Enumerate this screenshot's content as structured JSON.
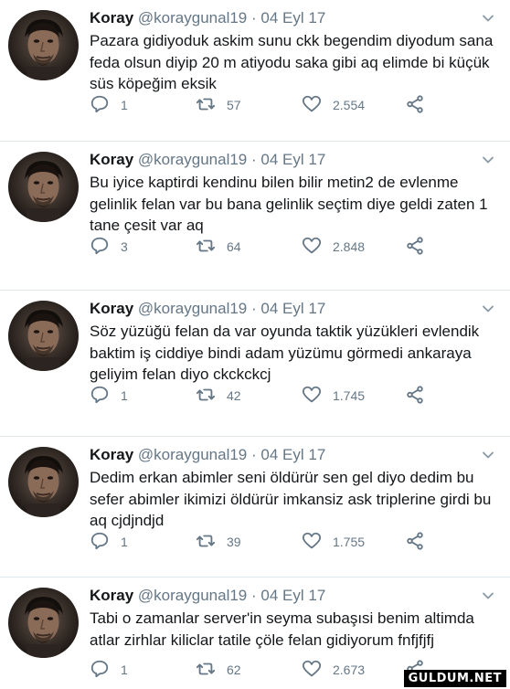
{
  "tweets": [
    {
      "name": "Koray",
      "handle": "@koraygunal19",
      "separator": "·",
      "date": "04 Eyl 17",
      "text": "Pazara gidiyoduk askim sunu ckk begendim diyodum sana feda olsun diyip 20 m atiyodu saka gibi aq elimde bi küçük süs köpeğim eksik",
      "replies": "1",
      "retweets": "57",
      "likes": "2.554"
    },
    {
      "name": "Koray",
      "handle": "@koraygunal19",
      "separator": "·",
      "date": "04 Eyl 17",
      "text": "Bu iyice kaptirdi kendinu bilen bilir metin2 de evlenme gelinlik felan var bu bana gelinlik seçtim diye geldi zaten 1 tane çesit var aq",
      "replies": "3",
      "retweets": "64",
      "likes": "2.848"
    },
    {
      "name": "Koray",
      "handle": "@koraygunal19",
      "separator": "·",
      "date": "04 Eyl 17",
      "text": "Söz yüzüğü felan da var oyunda taktik yüzükleri evlendik baktim iş ciddiye bindi adam yüzümu görmedi ankaraya geliyim felan diyo ckckckcj",
      "replies": "1",
      "retweets": "42",
      "likes": "1.745"
    },
    {
      "name": "Koray",
      "handle": "@koraygunal19",
      "separator": "·",
      "date": "04 Eyl 17",
      "text": "Dedim erkan abimler seni öldürür sen gel diyo dedim bu sefer abimler ikimizi öldürür imkansiz ask triplerine girdi bu aq cjdjndjd",
      "replies": "1",
      "retweets": "39",
      "likes": "1.755"
    },
    {
      "name": "Koray",
      "handle": "@koraygunal19",
      "separator": "·",
      "date": "04 Eyl 17",
      "text": "Tabi o zamanlar server'in seyma subaşısi benim altimda atlar zirhlar kiliclar tatile çöle felan gidiyorum fnfjfjfj",
      "replies": "1",
      "retweets": "62",
      "likes": "2.673"
    }
  ],
  "icons": {
    "reply": "reply-icon",
    "retweet": "retweet-icon",
    "like": "heart-icon",
    "share": "share-icon",
    "menu": "chevron-down-icon"
  },
  "colors": {
    "text": "#14171a",
    "muted": "#657786",
    "divider": "#e1e8ed"
  },
  "watermark": "GULDUM.NET"
}
